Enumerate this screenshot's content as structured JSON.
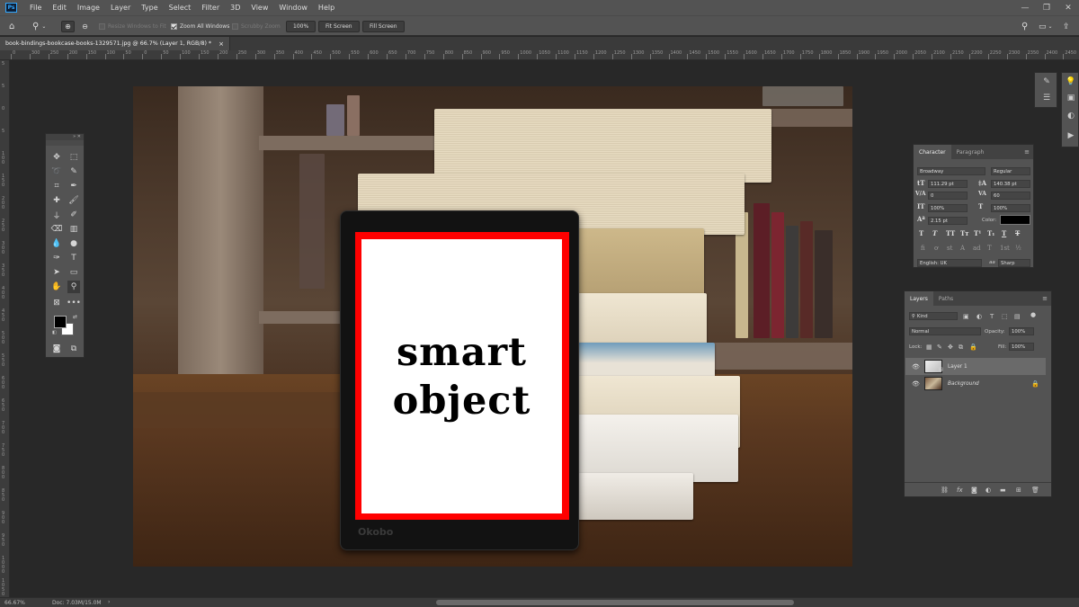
{
  "menubar": {
    "app_icon": "Ps",
    "items": [
      "File",
      "Edit",
      "Image",
      "Layer",
      "Type",
      "Select",
      "Filter",
      "3D",
      "View",
      "Window",
      "Help"
    ],
    "window_controls": [
      "minimize-icon",
      "maximize-icon",
      "close-icon"
    ]
  },
  "options_bar": {
    "resize_windows_label": "Resize Windows to Fit",
    "zoom_all_label": "Zoom All Windows",
    "scrubby_zoom_label": "Scrubby Zoom",
    "zoom_100_label": "100%",
    "fit_screen_label": "Fit Screen",
    "fill_screen_label": "Fill Screen",
    "zoom_all_checked": true
  },
  "document_tab": {
    "title": "book-bindings-bookcase-books-1329571.jpg @ 66.7% (Layer 1, RGB/8) *",
    "close": "×"
  },
  "ruler": {
    "h_labels": [
      "0",
      "300",
      "250",
      "200",
      "150",
      "100",
      "50",
      "0",
      "50",
      "100",
      "150",
      "200",
      "250",
      "300",
      "350",
      "400",
      "450",
      "500",
      "550",
      "600",
      "650",
      "700",
      "750",
      "800",
      "850",
      "900",
      "950",
      "1000",
      "1050",
      "1100",
      "1150",
      "1200",
      "1250",
      "1300",
      "1350",
      "1400",
      "1450",
      "1500",
      "1550",
      "1600",
      "1650",
      "1700",
      "1750",
      "1800",
      "1850",
      "1900",
      "1950",
      "2000",
      "2050",
      "2100",
      "2150",
      "2200",
      "2250",
      "2300",
      "2350",
      "2400",
      "2450"
    ],
    "v_labels": [
      "5",
      "5",
      "0",
      "5",
      "1\n0\n0",
      "1\n5\n0",
      "2\n0\n0",
      "2\n5\n0",
      "3\n0\n0",
      "3\n5\n0",
      "4\n0\n0",
      "4\n5\n0",
      "5\n0\n0",
      "5\n5\n0",
      "6\n0\n0",
      "6\n5\n0",
      "7\n0\n0",
      "7\n5\n0",
      "8\n0\n0",
      "8\n5\n0",
      "9\n0\n0",
      "9\n5\n0",
      "1\n0\n0\n0",
      "1\n0\n5\n0",
      "1\n1\n0\n0"
    ]
  },
  "canvas": {
    "smart_object_text_line1": "smart",
    "smart_object_text_line2": "object",
    "device_brand": "Okobo",
    "frame_color": "#ff0000"
  },
  "character_panel": {
    "tabs": [
      "Character",
      "Paragraph"
    ],
    "font_family": "Broadway",
    "font_style": "Regular",
    "font_size": "111.29 pt",
    "leading": "140.38 pt",
    "kerning": "0",
    "tracking": "60",
    "vertical_scale": "100%",
    "horizontal_scale": "100%",
    "baseline_shift": "2.15 pt",
    "color_label": "Color:",
    "color_value": "#000000",
    "type_styles": [
      "T",
      "T",
      "TT",
      "Tт",
      "T¹",
      "T₁",
      "T",
      "T"
    ],
    "opentype": [
      "fi",
      "ơ",
      "st",
      "A",
      "ad",
      "T",
      "1st",
      "½"
    ],
    "language": "English: UK",
    "antialias_label": "aa",
    "antialias": "Sharp"
  },
  "layers_panel": {
    "tabs": [
      "Layers",
      "Paths"
    ],
    "filter_kind": "Kind",
    "blend_mode": "Normal",
    "opacity_label": "Opacity:",
    "opacity": "100%",
    "lock_label": "Lock:",
    "fill_label": "Fill:",
    "fill": "100%",
    "layers": [
      {
        "name": "Layer 1",
        "selected": true,
        "visible": true,
        "smart": true
      },
      {
        "name": "Background",
        "selected": false,
        "visible": true,
        "locked": true
      }
    ],
    "footer_icons": [
      "link-icon",
      "fx-icon",
      "mask-icon",
      "adjustment-icon",
      "folder-icon",
      "new-layer-icon",
      "trash-icon"
    ]
  },
  "status_bar": {
    "zoom": "66.67%",
    "doc_info": "Doc: 7.03M/15.0M"
  }
}
